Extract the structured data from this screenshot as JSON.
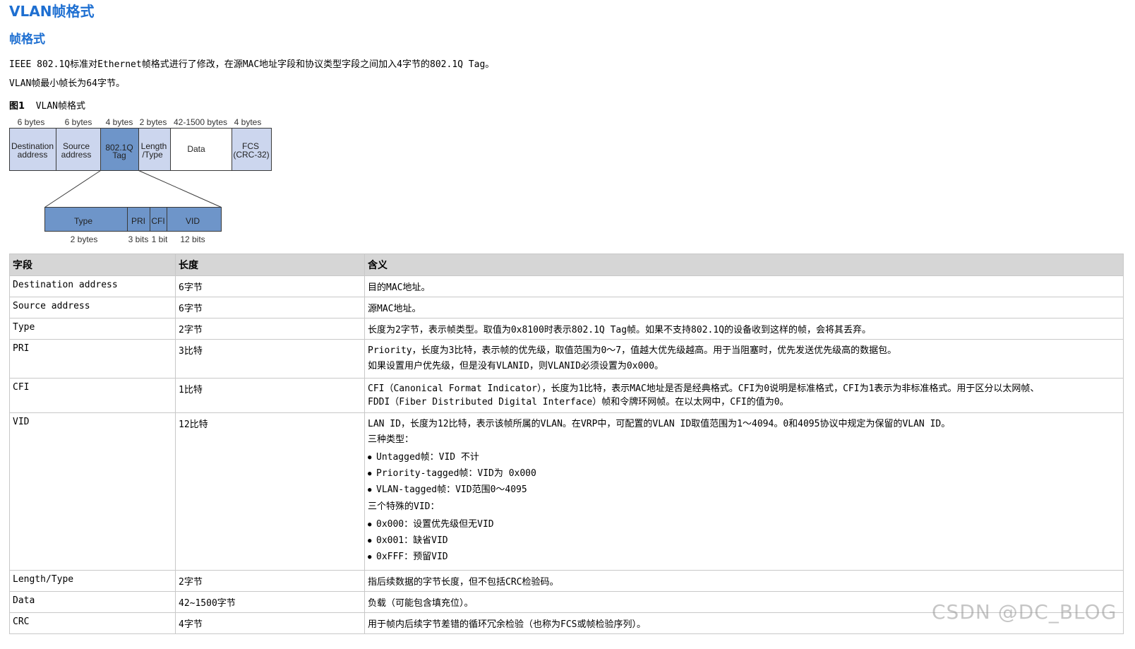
{
  "title": "VLAN帧格式",
  "subtitle": "帧格式",
  "intro": [
    "IEEE 802.1Q标准对Ethernet帧格式进行了修改，在源MAC地址字段和协议类型字段之间加入4字节的802.1Q Tag。",
    "VLAN帧最小帧长为64字节。"
  ],
  "figure": {
    "label": "图1",
    "caption": "VLAN帧格式",
    "fields": [
      {
        "size": "6 bytes",
        "line1": "Destination",
        "line2": "address"
      },
      {
        "size": "6 bytes",
        "line1": "Source",
        "line2": "address"
      },
      {
        "size": "4 bytes",
        "line1": "802.1Q",
        "line2": "Tag"
      },
      {
        "size": "2 bytes",
        "line1": "Length",
        "line2": "/Type"
      },
      {
        "size": "42-1500 bytes",
        "line1": "Data",
        "line2": ""
      },
      {
        "size": "4 bytes",
        "line1": "FCS",
        "line2": "(CRC-32)"
      }
    ],
    "tag_fields": [
      {
        "label": "Type",
        "size": "2 bytes"
      },
      {
        "label": "PRI",
        "size": "3 bits"
      },
      {
        "label": "CFI",
        "size": "1 bit"
      },
      {
        "label": "VID",
        "size": "12 bits"
      }
    ],
    "colors": {
      "light": "#ccd6ee",
      "dark": "#6e95c9",
      "border": "#3a3a3a"
    }
  },
  "table": {
    "headers": [
      "字段",
      "长度",
      "含义"
    ],
    "rows": [
      {
        "field": "Destination address",
        "length": "6字节",
        "meaning": "目的MAC地址。"
      },
      {
        "field": "Source address",
        "length": "6字节",
        "meaning": "源MAC地址。"
      },
      {
        "field": "Type",
        "length": "2字节",
        "meaning": "长度为2字节，表示帧类型。取值为0x8100时表示802.1Q Tag帧。如果不支持802.1Q的设备收到这样的帧，会将其丢弃。"
      },
      {
        "field": "PRI",
        "length": "3比特",
        "meaning": "Priority，长度为3比特，表示帧的优先级，取值范围为0～7，值越大优先级越高。用于当阻塞时，优先发送优先级高的数据包。",
        "meaning2": "如果设置用户优先级，但是没有VLANID，则VLANID必须设置为0x000。"
      },
      {
        "field": "CFI",
        "length": "1比特",
        "meaning": "CFI（Canonical Format Indicator），长度为1比特，表示MAC地址是否是经典格式。CFI为0说明是标准格式，CFI为1表示为非标准格式。用于区分以太网帧、",
        "meaning2": "FDDI（Fiber Distributed Digital Interface）帧和令牌环网帧。在以太网中，CFI的值为0。"
      },
      {
        "field": "VID",
        "length": "12比特",
        "meaning": "LAN ID，长度为12比特，表示该帧所属的VLAN。在VRP中，可配置的VLAN ID取值范围为1～4094。0和4095协议中规定为保留的VLAN ID。",
        "types_heading": "三种类型：",
        "types": [
          "Untagged帧：VID 不计",
          "Priority-tagged帧：VID为 0x000",
          "VLAN-tagged帧：VID范围0～4095"
        ],
        "special_heading": "三个特殊的VID：",
        "special": [
          "0x000：设置优先级但无VID",
          "0x001：缺省VID",
          "0xFFF：预留VID"
        ]
      },
      {
        "field": "Length/Type",
        "length": "2字节",
        "meaning": "指后续数据的字节长度，但不包括CRC检验码。"
      },
      {
        "field": "Data",
        "length": "42~1500字节",
        "meaning": "负载（可能包含填充位）。"
      },
      {
        "field": "CRC",
        "length": "4字节",
        "meaning": "用于帧内后续字节差错的循环冗余检验（也称为FCS或帧检验序列）。"
      }
    ]
  },
  "watermark": "CSDN @DC_BLOG"
}
